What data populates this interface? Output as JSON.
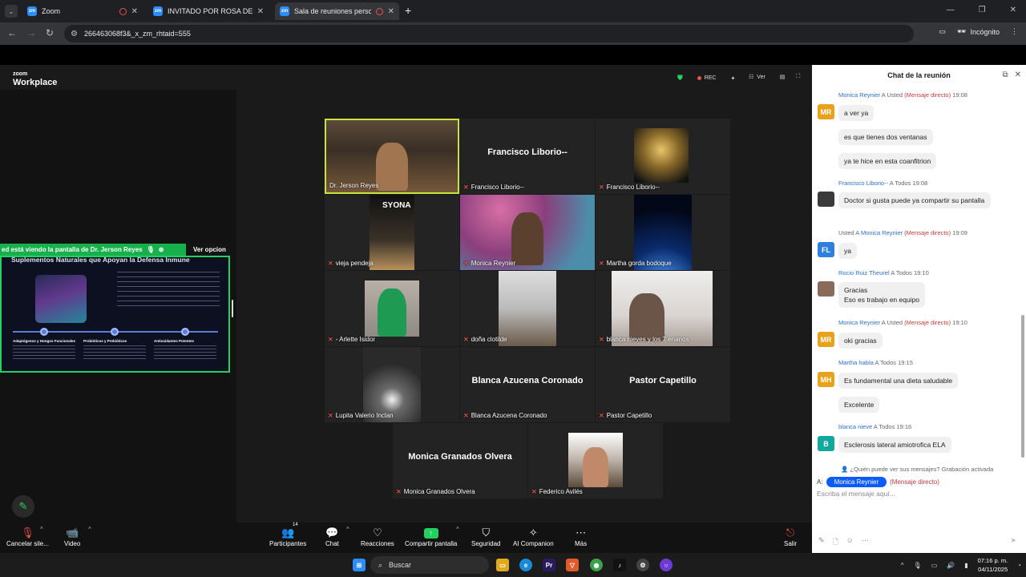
{
  "browser": {
    "tabs": [
      {
        "label": "Zoom",
        "favicon": "zoom-icon",
        "recording": true
      },
      {
        "label": "INVITADO POR ROSA DE PAZ",
        "favicon": "zoom-icon",
        "recording": false
      },
      {
        "label": "Sala de reuniones personal",
        "favicon": "zoom-icon",
        "recording": true,
        "active": true
      }
    ],
    "favicon_text": "zm",
    "url": "266463068f3&_x_zm_rhtaid=555",
    "profile_label": "Incógnito"
  },
  "zoom": {
    "logo_top": "zoom",
    "logo_bottom": "Workplace",
    "rec_label": "REC",
    "view_label": "Ver",
    "share_banner": "ed está viendo la pantalla de  Dr. Jerson Reyes",
    "share_options": "Ver opcion",
    "slide_title": "Suplementos Naturales que Apoyan la Defensa Inmune",
    "slide_columns": [
      "Adaptógenos y Hongos Funcionales",
      "Probióticos y Prebióticos",
      "Antioxidantes Potentes"
    ],
    "syona_brand": "SYONA",
    "tiles": [
      {
        "name": "Dr. Jerson Reyes",
        "video": "office",
        "speaking": true
      },
      {
        "name": "Francisco Liborio--",
        "big_name": "Francisco Liborio--"
      },
      {
        "name": "Francisco Liborio--",
        "video": "gold"
      },
      {
        "name": "vieja pendeja",
        "video": "syona"
      },
      {
        "name": "Monica Reynier",
        "video": "pink"
      },
      {
        "name": "Martha gorda bodoque",
        "video": "space"
      },
      {
        "name": "- Arlette Isidor",
        "video": "green"
      },
      {
        "name": "doña clotilde",
        "video": "room"
      },
      {
        "name": "blanca nieves y los 7 enanos",
        "video": "elder"
      },
      {
        "name": "Lupita Valerio Inclan",
        "video": "dark"
      },
      {
        "name": "Blanca Azucena Coronado",
        "big_name": "Blanca Azucena Coronado"
      },
      {
        "name": "Pastor Capetillo",
        "big_name": "Pastor Capetillo"
      },
      {
        "name": "Monica Granados Olvera",
        "big_name": "Monica Granados Olvera"
      },
      {
        "name": "Federico Avilés",
        "video": "fed"
      }
    ],
    "toolbar": {
      "mute": "Cancelar sile...",
      "video": "Video",
      "participants": "Participantes",
      "participants_count": "14",
      "chat": "Chat",
      "reactions": "Reacciones",
      "share": "Compartir pantalla",
      "security": "Seguridad",
      "ai": "AI Companion",
      "more": "Más",
      "leave": "Salir"
    }
  },
  "chat": {
    "title": "Chat de la reunión",
    "messages": [
      {
        "from": "Monica Reynier",
        "to": "Usted",
        "dm": "(Mensaje directo)",
        "time": "19:08",
        "initials": "MR",
        "color": "#e8a21a",
        "lines": [
          "a ver ya",
          "es que tienes dos ventanas",
          "ya te hice en esta coanfitrion"
        ]
      },
      {
        "from": "Francisco Liborio--",
        "to": "Todos",
        "time": "19:08",
        "initials": "",
        "color": "#3a3a3a",
        "lines": [
          "Doctor si gusta puede ya compartir su pantalla"
        ]
      },
      {
        "from": "Usted",
        "to": "Monica Reynier",
        "dm": "(Mensaje directo)",
        "time": "19:09",
        "initials": "FL",
        "color": "#2d7fe0",
        "lines": [
          "ya"
        ]
      },
      {
        "from": "Rocio Ruiz Theurel",
        "to": "Todos",
        "time": "19:10",
        "initials": "",
        "color": "#8a6a5a",
        "lines": [
          "Gracias\nEso es trabajo en equipo"
        ]
      },
      {
        "from": "Monica Reynier",
        "to": "Usted",
        "dm": "(Mensaje directo)",
        "time": "19:10",
        "initials": "MR",
        "color": "#e8a21a",
        "lines": [
          "oki gracias"
        ]
      },
      {
        "from": "Martha habla",
        "to": "Todos",
        "time": "19:15",
        "initials": "MH",
        "color": "#e8a21a",
        "lines": [
          "Es fundamental una dieta saludable",
          "Excelente"
        ]
      },
      {
        "from": "blanca nieve",
        "to": "Todos",
        "time": "19:16",
        "initials": "B",
        "color": "#13a89e",
        "lines": [
          "Esclerosis lateral amiotrofica ELA"
        ]
      }
    ],
    "arrow": "A",
    "who_sees": "¿Quién puede ver sus mensajes? Grabación activada",
    "to_label": "A:",
    "recipient": "Monica Reynier",
    "recipient_dm": "(Mensaje directo)",
    "placeholder": "Escriba el mensaje aquí..."
  },
  "taskbar": {
    "search_label": "Buscar",
    "time": "07:16 p. m.",
    "date": "04/11/2025"
  }
}
